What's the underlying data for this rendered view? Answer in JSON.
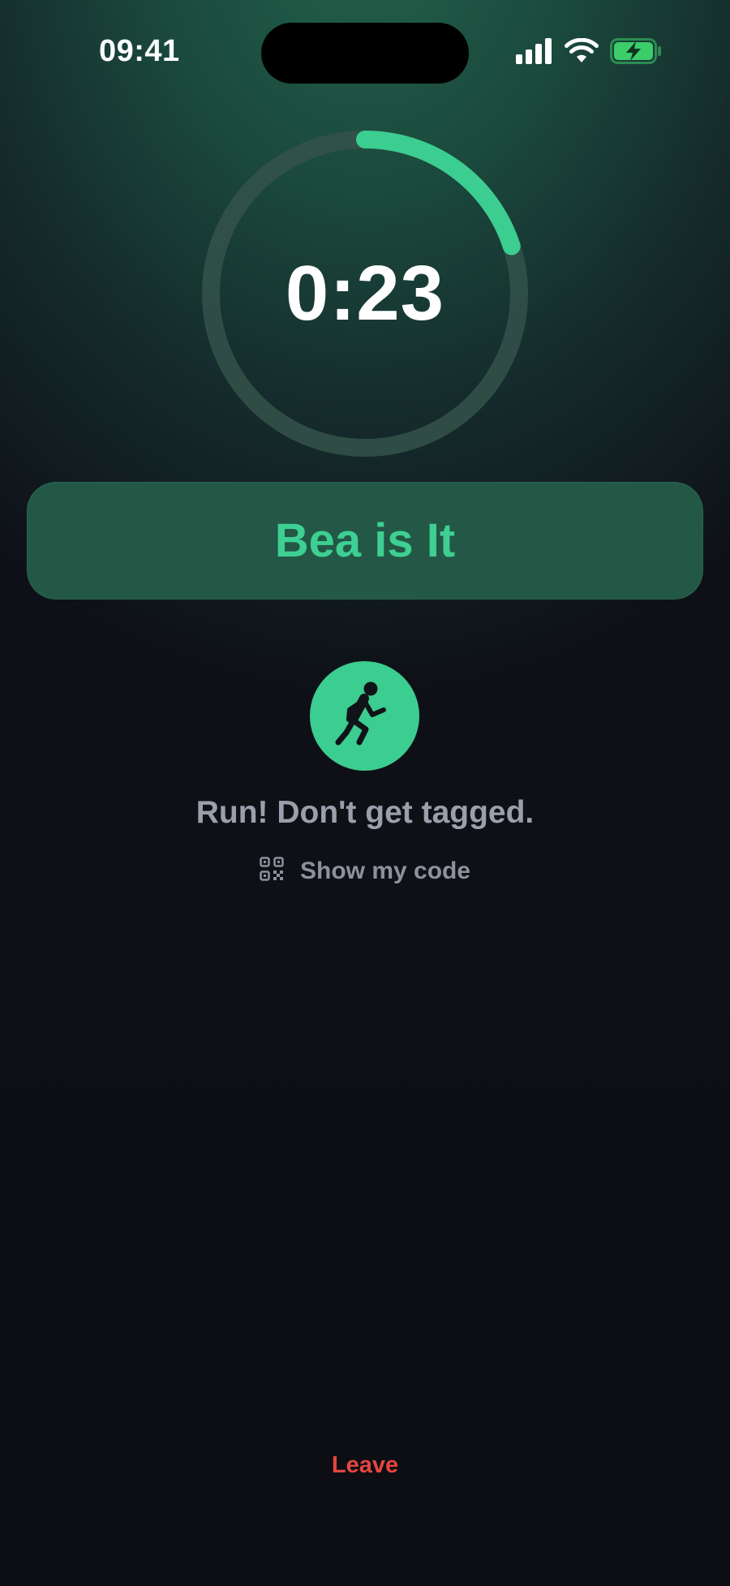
{
  "status_bar": {
    "time": "09:41",
    "signal_icon": "cellular-signal-icon",
    "wifi_icon": "wifi-icon",
    "battery_icon": "battery-charging-icon"
  },
  "timer": {
    "display": "0:23",
    "progress": 0.2
  },
  "banner": {
    "text": "Bea is It"
  },
  "player": {
    "icon": "running-person-icon",
    "instruction": "Run! Don't get tagged."
  },
  "show_code": {
    "icon": "qr-code-icon",
    "label": "Show my code"
  },
  "leave": {
    "label": "Leave"
  },
  "colors": {
    "accent": "#3ccd90",
    "banner_bg": "#235847",
    "danger": "#e6453f",
    "muted_text": "#9aa0ab",
    "ring_track": "#34524a"
  }
}
